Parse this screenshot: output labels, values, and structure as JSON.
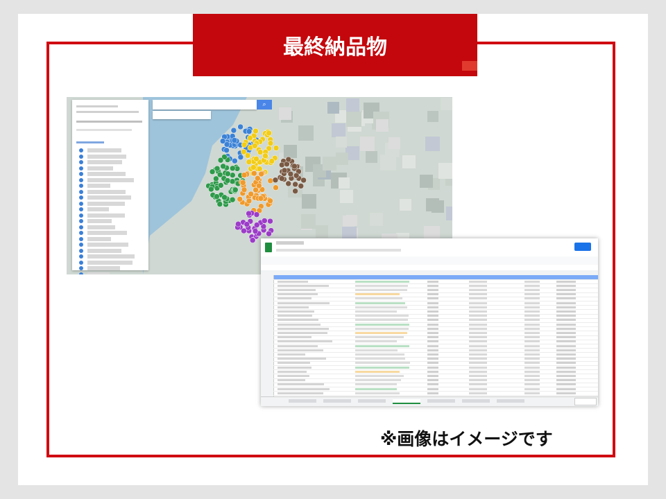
{
  "title": "最終納品物",
  "note": "※画像はイメージです",
  "colors": {
    "frame": "#d00c12",
    "title_bg": "#c4070c",
    "accent": "#e03a2e",
    "cluster_blue": "#3b82d6",
    "cluster_green": "#2e9a4a",
    "cluster_yellow": "#f2cc16",
    "cluster_orange": "#f09a2c",
    "cluster_brown": "#7a5a44",
    "cluster_purple": "#9c3cc8",
    "sheet_header": "#7baaf7"
  },
  "map": {
    "search_button_icon": "search-icon"
  }
}
